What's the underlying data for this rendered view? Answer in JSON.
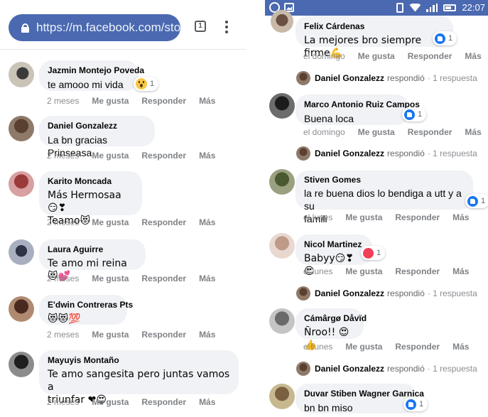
{
  "left": {
    "url": "https://m.facebook.com/stor",
    "tab_count": "1",
    "comments": [
      {
        "author": "Jazmin Montejo Poveda",
        "text": "te amooo mi vida",
        "time": "2 meses",
        "like": "Me gusta",
        "reply": "Responder",
        "more": "Más",
        "reaction_count": "1",
        "reaction": "wow-icon"
      },
      {
        "author": "Daniel Gonzalezz",
        "text": "La bn gracias Prinseasa",
        "time": "2 meses",
        "like": "Me gusta",
        "reply": "Responder",
        "more": "Más"
      },
      {
        "author": "Karito Moncada",
        "text_line1": "Más Hermosaa😏❣",
        "text_line2": "Teamo😻",
        "time": "2 meses",
        "like": "Me gusta",
        "reply": "Responder",
        "more": "Más"
      },
      {
        "author": "Laura Aguirre",
        "text": "Te amo mi reina😻💕",
        "time": "2 meses",
        "like": "Me gusta",
        "reply": "Responder",
        "more": "Más"
      },
      {
        "author": "E'dwin Contreras Pts",
        "text": "😻😻💯",
        "time": "2 meses",
        "like": "Me gusta",
        "reply": "Responder",
        "more": "Más"
      },
      {
        "author": "Mayuyis Montaño",
        "text_line1": "Te amo sangesita pero juntas vamos a",
        "text_line2": "triunfar ❤😍",
        "time": "2 meses",
        "like": "Me gusta",
        "reply": "Responder",
        "more": "Más"
      }
    ]
  },
  "right": {
    "status_time": "22:07",
    "comments": [
      {
        "author": "Felix Cárdenas",
        "text": "La mejores bro siempre firme💪",
        "time": "el domingo",
        "like": "Me gusta",
        "reply": "Responder",
        "more": "Más",
        "reaction_count": "1",
        "reaction": "like-icon",
        "replier": "Daniel Gonzalezz",
        "replied": "respondió",
        "reply_count": "· 1 respuesta"
      },
      {
        "author": "Marco Antonio Ruiz Campos",
        "text": "Buena loca",
        "time": "el domingo",
        "like": "Me gusta",
        "reply": "Responder",
        "more": "Más",
        "reaction_count": "1",
        "reaction": "like-icon",
        "replier": "Daniel Gonzalezz",
        "replied": "respondió",
        "reply_count": "· 1 respuesta"
      },
      {
        "author": "Stiven Gomes",
        "text_line1": "la re buena dios lo bendiga a utt y a su",
        "text_line2": "famili",
        "time": "el lunes",
        "like": "Me gusta",
        "reply": "Responder",
        "more": "Más",
        "reaction_count": "1",
        "reaction": "like-icon"
      },
      {
        "author": "Nicol Martinez",
        "text": "Babyy😏❣😍",
        "time": "el lunes",
        "like": "Me gusta",
        "reply": "Responder",
        "more": "Más",
        "reaction_count": "1",
        "reaction": "heart",
        "replier": "Daniel Gonzalezz",
        "replied": "respondió",
        "reply_count": "· 1 respuesta"
      },
      {
        "author": "Cámârgø Dåvïd",
        "text": "Ñroo!! 😍👍",
        "time": "el lunes",
        "like": "Me gusta",
        "reply": "Responder",
        "more": "Más",
        "replier": "Daniel Gonzalezz",
        "replied": "respondió",
        "reply_count": "· 1 respuesta"
      },
      {
        "author": "Duvar Stiben Wagner Garnica",
        "text": "bn bn miso",
        "reaction_count": "1",
        "reaction": "like-icon"
      }
    ]
  },
  "colors": {
    "facebook_blue": "#4a69b0",
    "like_blue": "#1877f2",
    "bubble": "#f0f2f5",
    "meta_gray": "#8a8d91"
  }
}
